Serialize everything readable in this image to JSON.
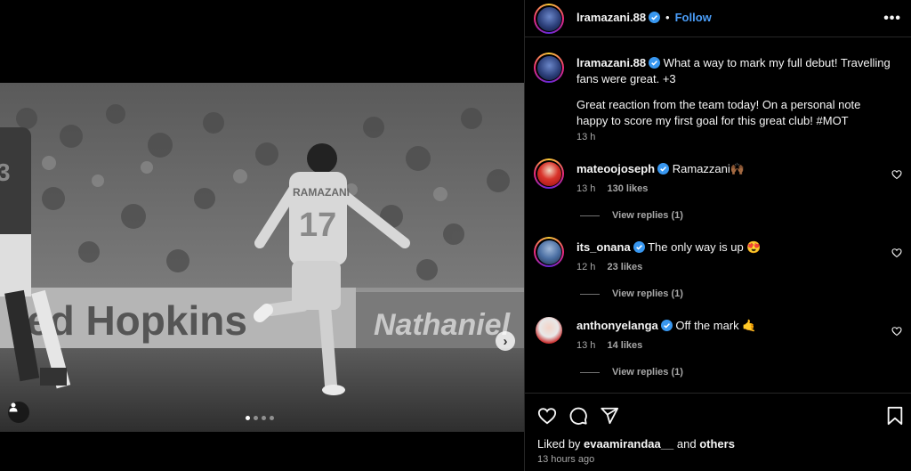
{
  "post": {
    "username": "lramazani.88",
    "follow_label": "Follow",
    "caption_line1": "What a way to mark my full debut! Travelling fans were great. +3",
    "caption_line2": "Great reaction from the team today! On a personal note happy to score my first goal for this great club! #MOT",
    "caption_time": "13 h",
    "accent_color": "#4a9df8",
    "verified_color": "#3897f0"
  },
  "media": {
    "banner_text_left": "ed Hopkins",
    "banner_text_right": "Nathaniel",
    "shirt_name": "RAMAZANI",
    "shirt_number": "17",
    "opponent_number": "3",
    "carousel_count": 4,
    "carousel_active": 1,
    "next_icon": "chevron-right-icon",
    "tag_icon": "person-icon"
  },
  "comments": [
    {
      "username": "mateoojoseph",
      "text": "Ramazzani🙌🏾",
      "time": "13 h",
      "likes": "130 likes",
      "replies": "View replies (1)"
    },
    {
      "username": "its_onana",
      "text": "The only way is up 😍",
      "time": "12 h",
      "likes": "23 likes",
      "replies": "View replies (1)"
    },
    {
      "username": "anthonyelanga",
      "text": "Off the mark 🤙",
      "time": "13 h",
      "likes": "14 likes",
      "replies": "View replies (1)"
    }
  ],
  "footer": {
    "liked_by_prefix": "Liked by",
    "liked_by_user": "evaamirandaa__",
    "liked_by_and": "and",
    "liked_by_others": "others",
    "timestamp": "13 hours ago"
  }
}
